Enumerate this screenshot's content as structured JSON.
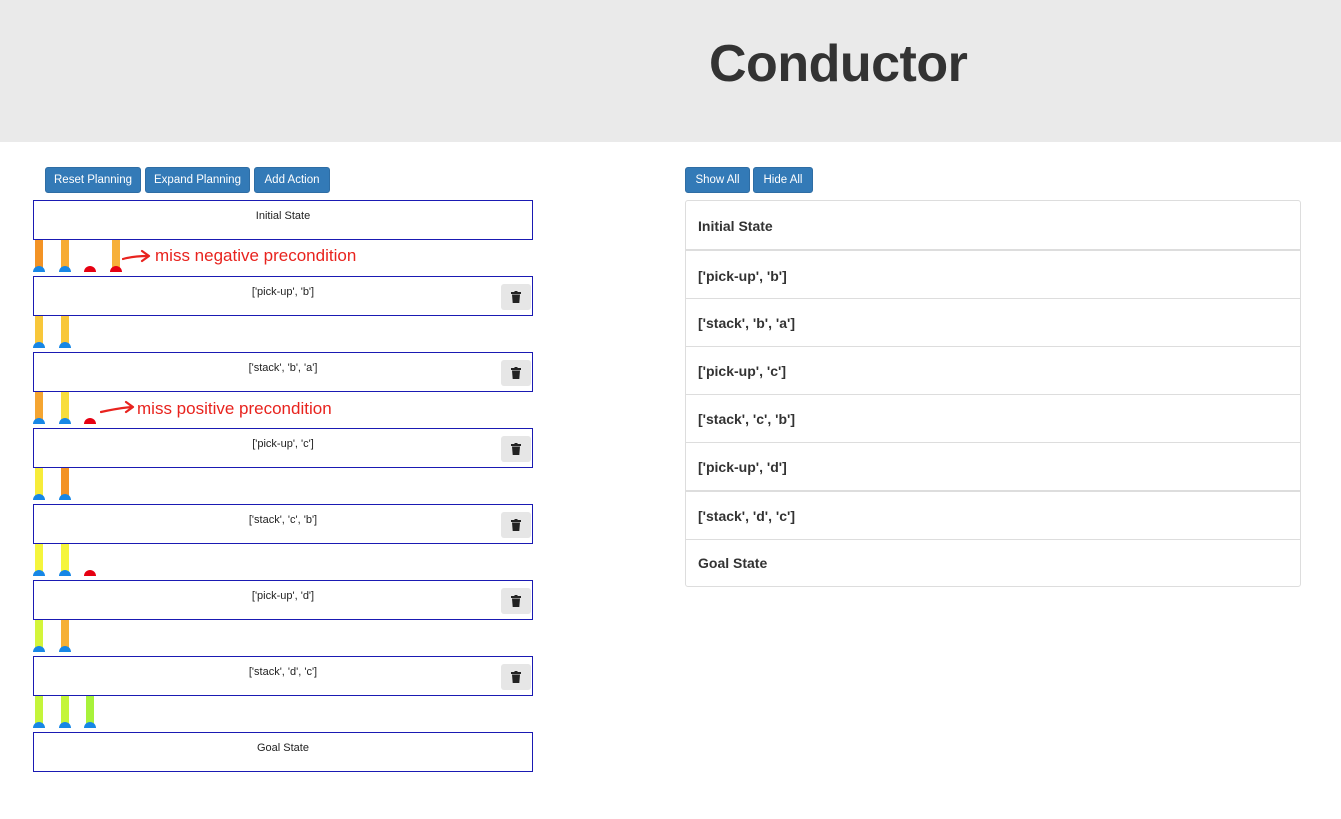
{
  "header": {
    "title": "Conductor"
  },
  "planning_toolbar": {
    "reset_label": "Reset Planning",
    "expand_label": "Expand Planning",
    "add_label": "Add Action"
  },
  "list_toolbar": {
    "show_all_label": "Show All",
    "hide_all_label": "Hide All"
  },
  "plan": {
    "initial_state": "Initial State",
    "goal_state": "Goal State",
    "actions": [
      "['pick-up', 'b']",
      "['stack', 'b', 'a']",
      "['pick-up', 'c']",
      "['stack', 'c', 'b']",
      "['pick-up', 'd']",
      "['stack', 'd', 'c']"
    ]
  },
  "annotations": {
    "negative": "miss negative precondition",
    "positive": "miss positive precondition",
    "color": "#e8231e"
  },
  "action_list": {
    "items": [
      "Initial State",
      "['pick-up', 'b']",
      "['stack', 'b', 'a']",
      "['pick-up', 'c']",
      "['stack', 'c', 'b']",
      "['pick-up', 'd']",
      "['stack', 'd', 'c']",
      "Goal State"
    ]
  },
  "colors": {
    "accent": "#337ab7",
    "step_border": "#1a1ab3",
    "connector_blue": "#1787e6",
    "connector_red": "#e60012"
  },
  "icons": {
    "delete": "trash-icon"
  }
}
